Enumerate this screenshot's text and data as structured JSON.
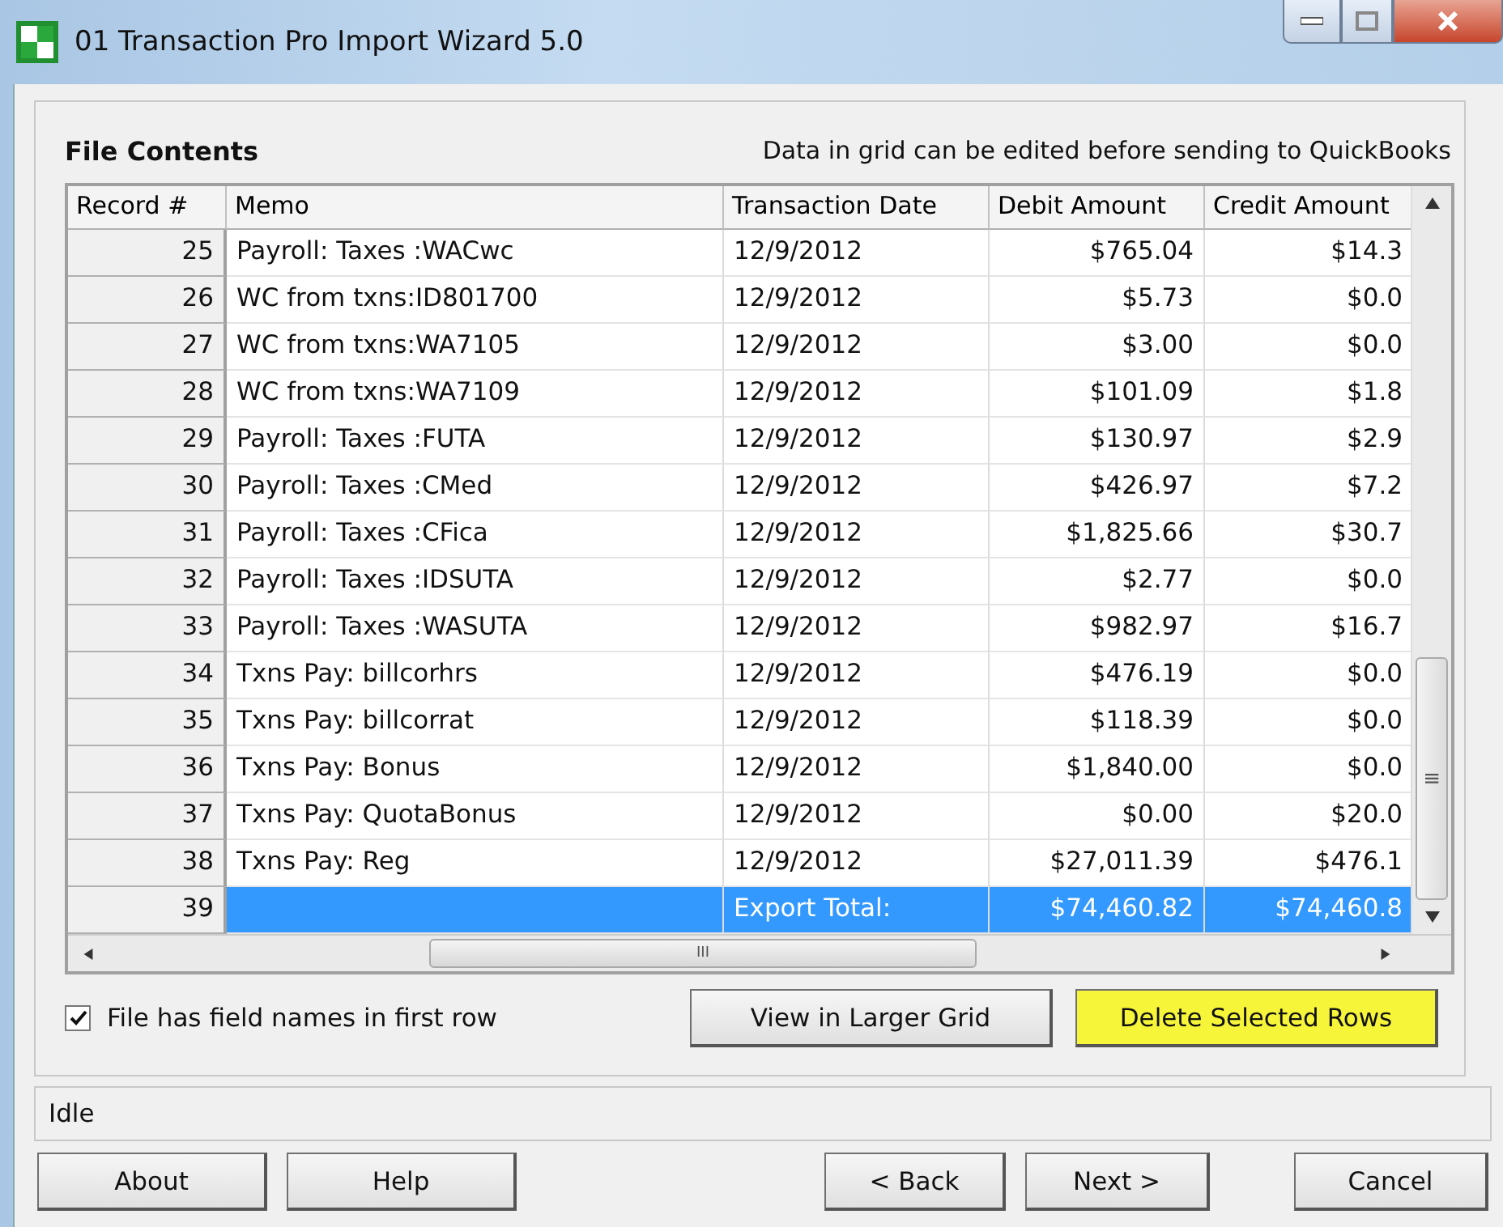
{
  "window": {
    "title": "01 Transaction Pro Import Wizard 5.0"
  },
  "group": {
    "title": "File Contents",
    "hint": "Data in grid can be edited before sending to QuickBooks"
  },
  "table": {
    "columns": [
      "Record #",
      "Memo",
      "Transaction Date",
      "Debit Amount",
      "Credit Amount"
    ],
    "rows": [
      {
        "cells": [
          "25",
          "Payroll: Taxes :WACwc",
          "12/9/2012",
          "$765.04",
          "$14.3"
        ],
        "selected": false
      },
      {
        "cells": [
          "26",
          "WC from txns:ID801700",
          "12/9/2012",
          "$5.73",
          "$0.0"
        ],
        "selected": false
      },
      {
        "cells": [
          "27",
          "WC from txns:WA7105",
          "12/9/2012",
          "$3.00",
          "$0.0"
        ],
        "selected": false
      },
      {
        "cells": [
          "28",
          "WC from txns:WA7109",
          "12/9/2012",
          "$101.09",
          "$1.8"
        ],
        "selected": false
      },
      {
        "cells": [
          "29",
          "Payroll: Taxes :FUTA",
          "12/9/2012",
          "$130.97",
          "$2.9"
        ],
        "selected": false
      },
      {
        "cells": [
          "30",
          "Payroll: Taxes :CMed",
          "12/9/2012",
          "$426.97",
          "$7.2"
        ],
        "selected": false
      },
      {
        "cells": [
          "31",
          "Payroll: Taxes :CFica",
          "12/9/2012",
          "$1,825.66",
          "$30.7"
        ],
        "selected": false
      },
      {
        "cells": [
          "32",
          "Payroll: Taxes :IDSUTA",
          "12/9/2012",
          "$2.77",
          "$0.0"
        ],
        "selected": false
      },
      {
        "cells": [
          "33",
          "Payroll: Taxes :WASUTA",
          "12/9/2012",
          "$982.97",
          "$16.7"
        ],
        "selected": false
      },
      {
        "cells": [
          "34",
          "Txns Pay: billcorhrs",
          "12/9/2012",
          "$476.19",
          "$0.0"
        ],
        "selected": false
      },
      {
        "cells": [
          "35",
          "Txns Pay: billcorrat",
          "12/9/2012",
          "$118.39",
          "$0.0"
        ],
        "selected": false
      },
      {
        "cells": [
          "36",
          "Txns Pay: Bonus",
          "12/9/2012",
          "$1,840.00",
          "$0.0"
        ],
        "selected": false
      },
      {
        "cells": [
          "37",
          "Txns Pay: QuotaBonus",
          "12/9/2012",
          "$0.00",
          "$20.0"
        ],
        "selected": false
      },
      {
        "cells": [
          "38",
          "Txns Pay: Reg",
          "12/9/2012",
          "$27,011.39",
          "$476.1"
        ],
        "selected": false
      },
      {
        "cells": [
          "39",
          "",
          "Export Total:",
          "$74,460.82",
          "$74,460.8"
        ],
        "selected": true
      }
    ]
  },
  "scrollbar_glyph": "≡",
  "hscroll_glyph": "III",
  "checkbox": {
    "label": "File has field names in first row",
    "checked": true
  },
  "grid_buttons": [
    {
      "label": "View in Larger Grid",
      "highlighted": false
    },
    {
      "label": "Delete Selected Rows",
      "highlighted": true
    }
  ],
  "status_bar": "Idle",
  "footer_buttons": [
    {
      "label": "About",
      "kind": "left"
    },
    {
      "label": "Help",
      "kind": "left"
    },
    {
      "label": "< Back",
      "kind": "nav"
    },
    {
      "label": "Next >",
      "kind": "nav"
    },
    {
      "label": "Cancel",
      "kind": "end"
    }
  ]
}
